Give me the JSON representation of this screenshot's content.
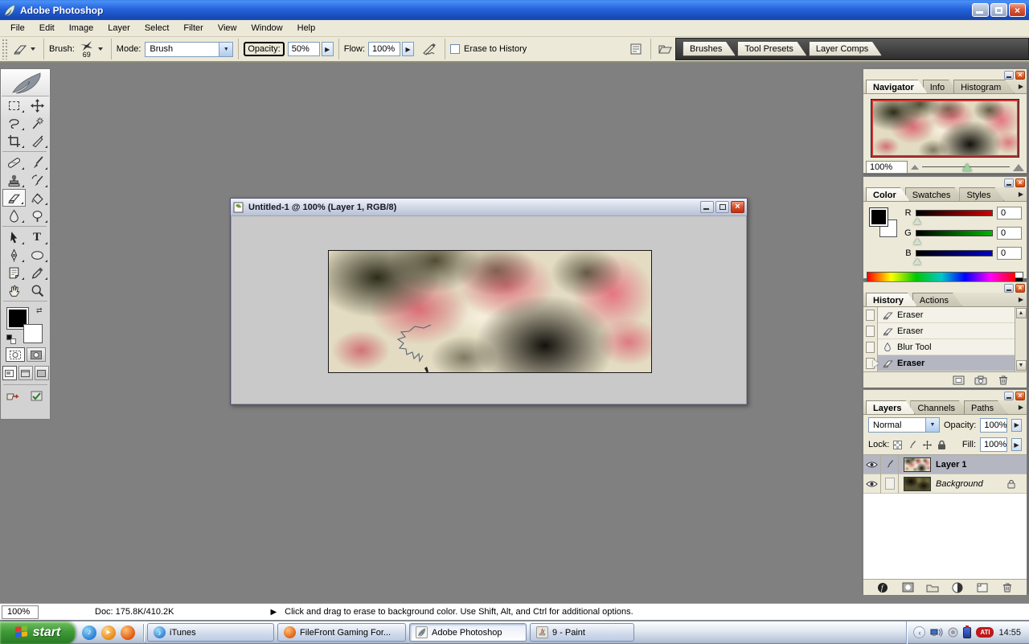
{
  "window": {
    "title": "Adobe Photoshop"
  },
  "menu": {
    "items": [
      "File",
      "Edit",
      "Image",
      "Layer",
      "Select",
      "Filter",
      "View",
      "Window",
      "Help"
    ]
  },
  "options_bar": {
    "brush_label": "Brush:",
    "brush_size": "69",
    "mode_label": "Mode:",
    "mode_value": "Brush",
    "opacity_label": "Opacity:",
    "opacity_value": "50%",
    "flow_label": "Flow:",
    "flow_value": "100%",
    "erase_history_label": "Erase to History",
    "palette_well_tabs": [
      "Brushes",
      "Tool Presets",
      "Layer Comps"
    ]
  },
  "document": {
    "title": "Untitled-1 @ 100% (Layer 1, RGB/8)"
  },
  "panels": {
    "navigator": {
      "tabs": [
        "Navigator",
        "Info",
        "Histogram"
      ],
      "zoom_value": "100%"
    },
    "color": {
      "tabs": [
        "Color",
        "Swatches",
        "Styles"
      ],
      "channels": [
        {
          "label": "R",
          "value": "0"
        },
        {
          "label": "G",
          "value": "0"
        },
        {
          "label": "B",
          "value": "0"
        }
      ]
    },
    "history": {
      "tabs": [
        "History",
        "Actions"
      ],
      "items": [
        {
          "label": "Eraser",
          "icon": "eraser-icon",
          "selected": false
        },
        {
          "label": "Eraser",
          "icon": "eraser-icon",
          "selected": false
        },
        {
          "label": "Blur Tool",
          "icon": "blur-icon",
          "selected": false
        },
        {
          "label": "Eraser",
          "icon": "eraser-icon",
          "selected": true
        }
      ]
    },
    "layers": {
      "tabs": [
        "Layers",
        "Channels",
        "Paths"
      ],
      "blend_mode": "Normal",
      "opacity_label": "Opacity:",
      "opacity_value": "100%",
      "lock_label": "Lock:",
      "fill_label": "Fill:",
      "fill_value": "100%",
      "rows": [
        {
          "name": "Layer 1",
          "selected": true,
          "locked": false
        },
        {
          "name": "Background",
          "selected": false,
          "locked": true
        }
      ]
    }
  },
  "status_bar": {
    "zoom": "100%",
    "doc_size": "Doc: 175.8K/410.2K",
    "hint": "Click and drag to erase to background color.  Use Shift, Alt, and Ctrl for additional options."
  },
  "taskbar": {
    "start_label": "start",
    "buttons": [
      {
        "label": "iTunes",
        "active": false
      },
      {
        "label": "FileFront Gaming For...",
        "active": false
      },
      {
        "label": "Adobe Photoshop",
        "active": true
      },
      {
        "label": "9 - Paint",
        "active": false
      }
    ],
    "clock": "14:55"
  },
  "glyphs": {
    "flyout": "▶",
    "spinner": "▶",
    "combo_arrow": "▼",
    "scroll_up": "▲",
    "scroll_down": "▼",
    "status_arrow": "▶",
    "close_x": "×",
    "chevron_left": "‹",
    "music_note": "♪",
    "play": "▸"
  },
  "colors": {
    "titlebar_blue": "#2563dd",
    "panel_beige": "#ece9d8",
    "workspace_gray": "#808080",
    "selection_gray": "#b4b6c2",
    "palette_well_dark": "#3a3a3a",
    "taskbar_silver": "#c3cedf",
    "start_green": "#3f9a37",
    "close_red": "#c13818",
    "navigator_view_red": "#cf3333",
    "canvas_base": "#e3dcc2"
  }
}
